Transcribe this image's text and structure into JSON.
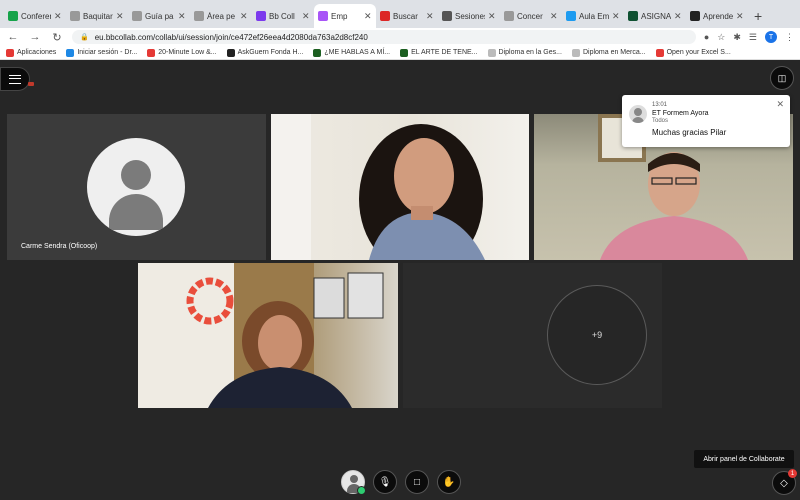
{
  "browser": {
    "tabs": [
      {
        "label": "Conferenc",
        "color": "#16a34a",
        "active": false
      },
      {
        "label": "Baquitar",
        "color": "#999999",
        "active": false
      },
      {
        "label": "Guía pa",
        "color": "#999999",
        "active": false
      },
      {
        "label": "Área pe",
        "color": "#999999",
        "active": false
      },
      {
        "label": "Bb Coll",
        "color": "#7c3aed",
        "active": false
      },
      {
        "label": "Emp",
        "color": "#a855f7",
        "active": true
      },
      {
        "label": "Buscar",
        "color": "#dc2626",
        "active": false
      },
      {
        "label": "Sesiones",
        "color": "#555555",
        "active": false
      },
      {
        "label": "Concer",
        "color": "#999999",
        "active": false
      },
      {
        "label": "Aula Em",
        "color": "#1d9bf0",
        "active": false
      },
      {
        "label": "ASIGNA",
        "color": "#0f5132",
        "active": false
      },
      {
        "label": "Aprende",
        "color": "#222222",
        "active": false
      }
    ],
    "new_tab": "+",
    "url": "eu.bbcollab.com/collab/ui/session/join/ce472ef26eea4d2080da763a2d8cf240",
    "bookmarks": [
      {
        "label": "Aplicaciones",
        "color": "#e53935"
      },
      {
        "label": "Iniciar sesión - Dr...",
        "color": "#1e88e5"
      },
      {
        "label": "20-Minute Low &...",
        "color": "#e53935"
      },
      {
        "label": "AskGuern Fonda H...",
        "color": "#222222"
      },
      {
        "label": "¿ME HABLAS A MÍ...",
        "color": "#1b5e20"
      },
      {
        "label": "EL ARTE DE TENE...",
        "color": "#1b5e20"
      },
      {
        "label": "Diploma en la Ges...",
        "color": "#bbbbbb"
      },
      {
        "label": "Diploma en Merca...",
        "color": "#bbbbbb"
      },
      {
        "label": "Open your Excel S...",
        "color": "#e53935"
      }
    ]
  },
  "collab": {
    "participants": [
      {
        "name": "Carme Sendra (Oficoop)"
      }
    ],
    "overflow_count": "+9",
    "notification": {
      "time": "13:01",
      "sender": "ET Formem Ayora",
      "to": "Todos",
      "message": "Muchas gracias Pilar"
    },
    "tooltip": "Abrir panel de Collaborate",
    "panel_badge": "1"
  }
}
